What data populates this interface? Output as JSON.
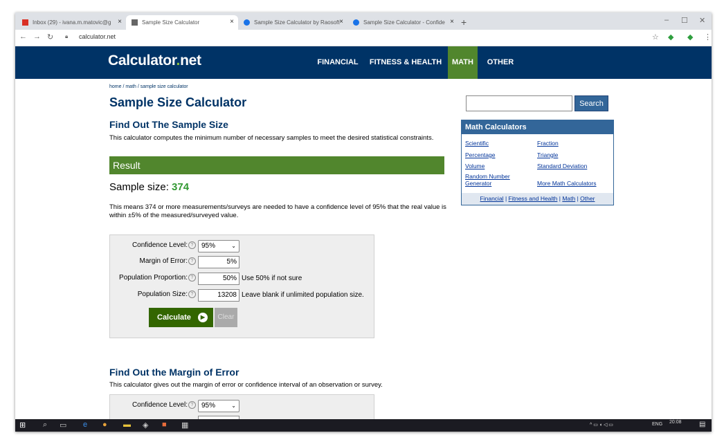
{
  "browser": {
    "tabs": [
      {
        "label": "Inbox (29) - ivana.m.matovic@g",
        "color": "#d93025"
      },
      {
        "label": "Sample Size Calculator",
        "color": "#666666"
      },
      {
        "label": "Sample Size Calculator by Raosoft",
        "color": "#1a73e8"
      },
      {
        "label": "Sample Size Calculator - Confide",
        "color": "#1a73e8"
      }
    ],
    "url": "calculator.net",
    "new_tab": "+",
    "close": "×"
  },
  "site": {
    "logo_main": "Calculator",
    "logo_dot": ".",
    "logo_tld": "net",
    "nav": [
      "FINANCIAL",
      "FITNESS & HEALTH",
      "MATH",
      "OTHER"
    ],
    "active_nav": "MATH"
  },
  "main": {
    "breadcrumb": "home / math / sample size calculator",
    "title": "Sample Size Calculator",
    "section1_title": "Find Out The Sample Size",
    "section1_desc": "This calculator computes the minimum number of necessary samples to meet the desired statistical constraints.",
    "result_label": "Result",
    "sample_size_label": "Sample size: ",
    "sample_size_value": "374",
    "result_text": "This means 374 or more measurements/surveys are needed to have a confidence level of 95% that the real value is within ±5% of the measured/surveyed value.",
    "form": {
      "confidence_label": "Confidence Level:",
      "confidence_value": "95%",
      "margin_label": "Margin of Error:",
      "margin_value": "5%",
      "proportion_label": "Population Proportion:",
      "proportion_value": "50%",
      "proportion_hint": "Use 50% if not sure",
      "size_label": "Population Size:",
      "size_value": "13208",
      "size_hint": "Leave blank if unlimited population size.",
      "calculate": "Calculate",
      "clear": "Clear"
    },
    "section2_title": "Find Out the Margin of Error",
    "section2_desc": "This calculator gives out the margin of error or confidence interval of an observation or survey.",
    "form2": {
      "confidence_label": "Confidence Level:",
      "confidence_value": "95%"
    }
  },
  "sidebar": {
    "search_button": "Search",
    "box_title": "Math Calculators",
    "links": [
      "Scientific",
      "Fraction",
      "Percentage",
      "Triangle",
      "Volume",
      "Standard Deviation",
      "Random Number Generator",
      "More Math Calculators"
    ],
    "footer": [
      "Financial",
      "Fitness and Health",
      "Math",
      "Other"
    ]
  },
  "taskbar": {
    "lang": "ENG",
    "time": "20:08"
  },
  "colors": {
    "header": "#003366",
    "accent_green": "#51862d",
    "sidebar_blue": "#336699"
  }
}
